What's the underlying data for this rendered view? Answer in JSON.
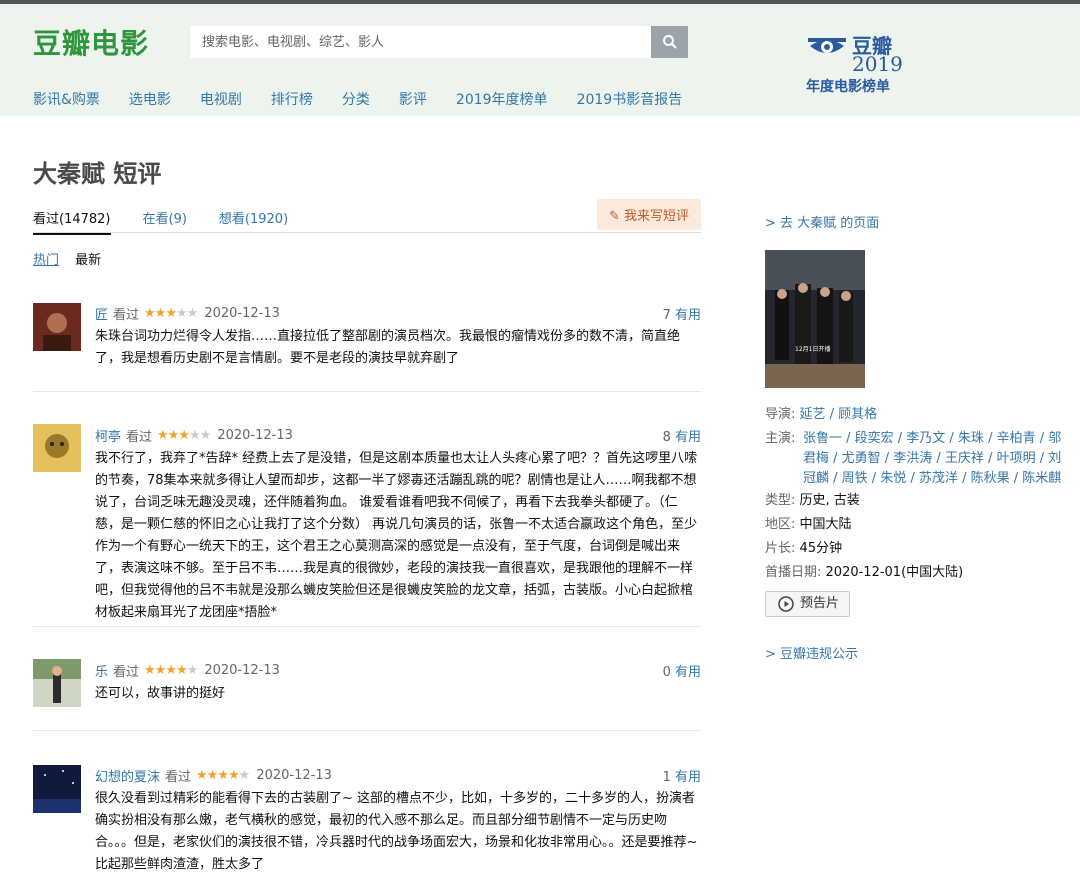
{
  "header": {
    "logo": "豆瓣电影",
    "search_placeholder": "搜索电影、电视剧、综艺、影人",
    "badge": {
      "l1": "豆瓣",
      "l2": "2019",
      "l3": "年度电影榜单"
    },
    "nav": [
      "影讯&购票",
      "选电影",
      "电视剧",
      "排行榜",
      "分类",
      "影评",
      "2019年度榜单",
      "2019书影音报告"
    ]
  },
  "main": {
    "title": "大秦赋 短评",
    "tabs": [
      "看过(14782)",
      "在看(9)",
      "想看(1920)"
    ],
    "write_button": "我来写短评",
    "sort": {
      "hot": "热门",
      "new": "最新"
    },
    "comments": [
      {
        "user": "匠",
        "status": "看过",
        "rating": 3,
        "date": "2020-12-13",
        "votes": "7",
        "votes_label": "有用",
        "text": "朱珠台词功力烂得令人发指……直接拉低了整部剧的演员档次。我最恨的瘤情戏份多的数不清，简直绝了，我是想看历史剧不是言情剧。要不是老段的演技早就弃剧了"
      },
      {
        "user": "柯亭",
        "status": "看过",
        "rating": 3,
        "date": "2020-12-13",
        "votes": "8",
        "votes_label": "有用",
        "text": "我不行了，我弃了*告辞* 经费上去了是没错，但是这剧本质量也太让人头疼心累了吧？？首先这啰里八嗦的节奏，78集本来就多得让人望而却步，这都一半了嫪毐还活蹦乱跳的呢？剧情也是让人……啊我都不想说了，台词乏味无趣没灵魂，还伴随着狗血。 谁爱看谁看吧我不伺候了，再看下去我拳头都硬了。（仁慈，是一颗仁慈的怀旧之心让我打了这个分数） 再说几句演员的话，张鲁一不太适合嬴政这个角色，至少作为一个有野心一统天下的王，这个君王之心莫测高深的感觉是一点没有，至于气度，台词倒是喊出来了，表演这味不够。至于吕不韦……我是真的很微妙，老段的演技我一直很喜欢，是我跟他的理解不一样吧，但我觉得他的吕不韦就是没那么蟣皮笑脸但还是很蟣皮笑脸的龙文章，括弧，古装版。小心白起掀棺材板起来扇耳光了龙团座*捂脸*"
      },
      {
        "user": "乐",
        "status": "看过",
        "rating": 4,
        "date": "2020-12-13",
        "votes": "0",
        "votes_label": "有用",
        "text": "还可以，故事讲的挺好"
      },
      {
        "user": "幻想的夏沫",
        "status": "看过",
        "rating": 4,
        "date": "2020-12-13",
        "votes": "1",
        "votes_label": "有用",
        "text": "很久没看到过精彩的能看得下去的古装剧了~ 这部的槽点不少，比如，十多岁的，二十多岁的人，扮演者确实扮相没有那么嫩，老气横秋的感觉，最初的代入感不那么足。而且部分细节剧情不一定与历史吻合。。。但是，老家伙们的演技很不错，冷兵器时代的战争场面宏大，场景和化妆非常用心。。还是要推荐~比起那些鲜肉渣渣，胜太多了"
      }
    ]
  },
  "side": {
    "go_link": "> 去 大秦赋 的页面",
    "poster_date": "12月1日开播",
    "director_label": "导演:",
    "director": "延艺 / 顾其格",
    "cast_label": "主演:",
    "cast": "张鲁一 / 段奕宏 / 李乃文 / 朱珠 / 辛柏青 / 邬君梅 / 尤勇智 / 李洪涛 / 王庆祥 / 叶项明 / 刘冠麟 / 周铁 / 朱悦 / 苏茂洋 / 陈秋果 / 陈米麒",
    "genre_label": "类型:",
    "genre": "历史, 古装",
    "region_label": "地区:",
    "region": "中国大陆",
    "length_label": "片长:",
    "length": "45分钟",
    "premiere_label": "首播日期:",
    "premiere": "2020-12-01(中国大陆)",
    "trailer": "预告片",
    "report_link": "> 豆瓣违规公示"
  }
}
